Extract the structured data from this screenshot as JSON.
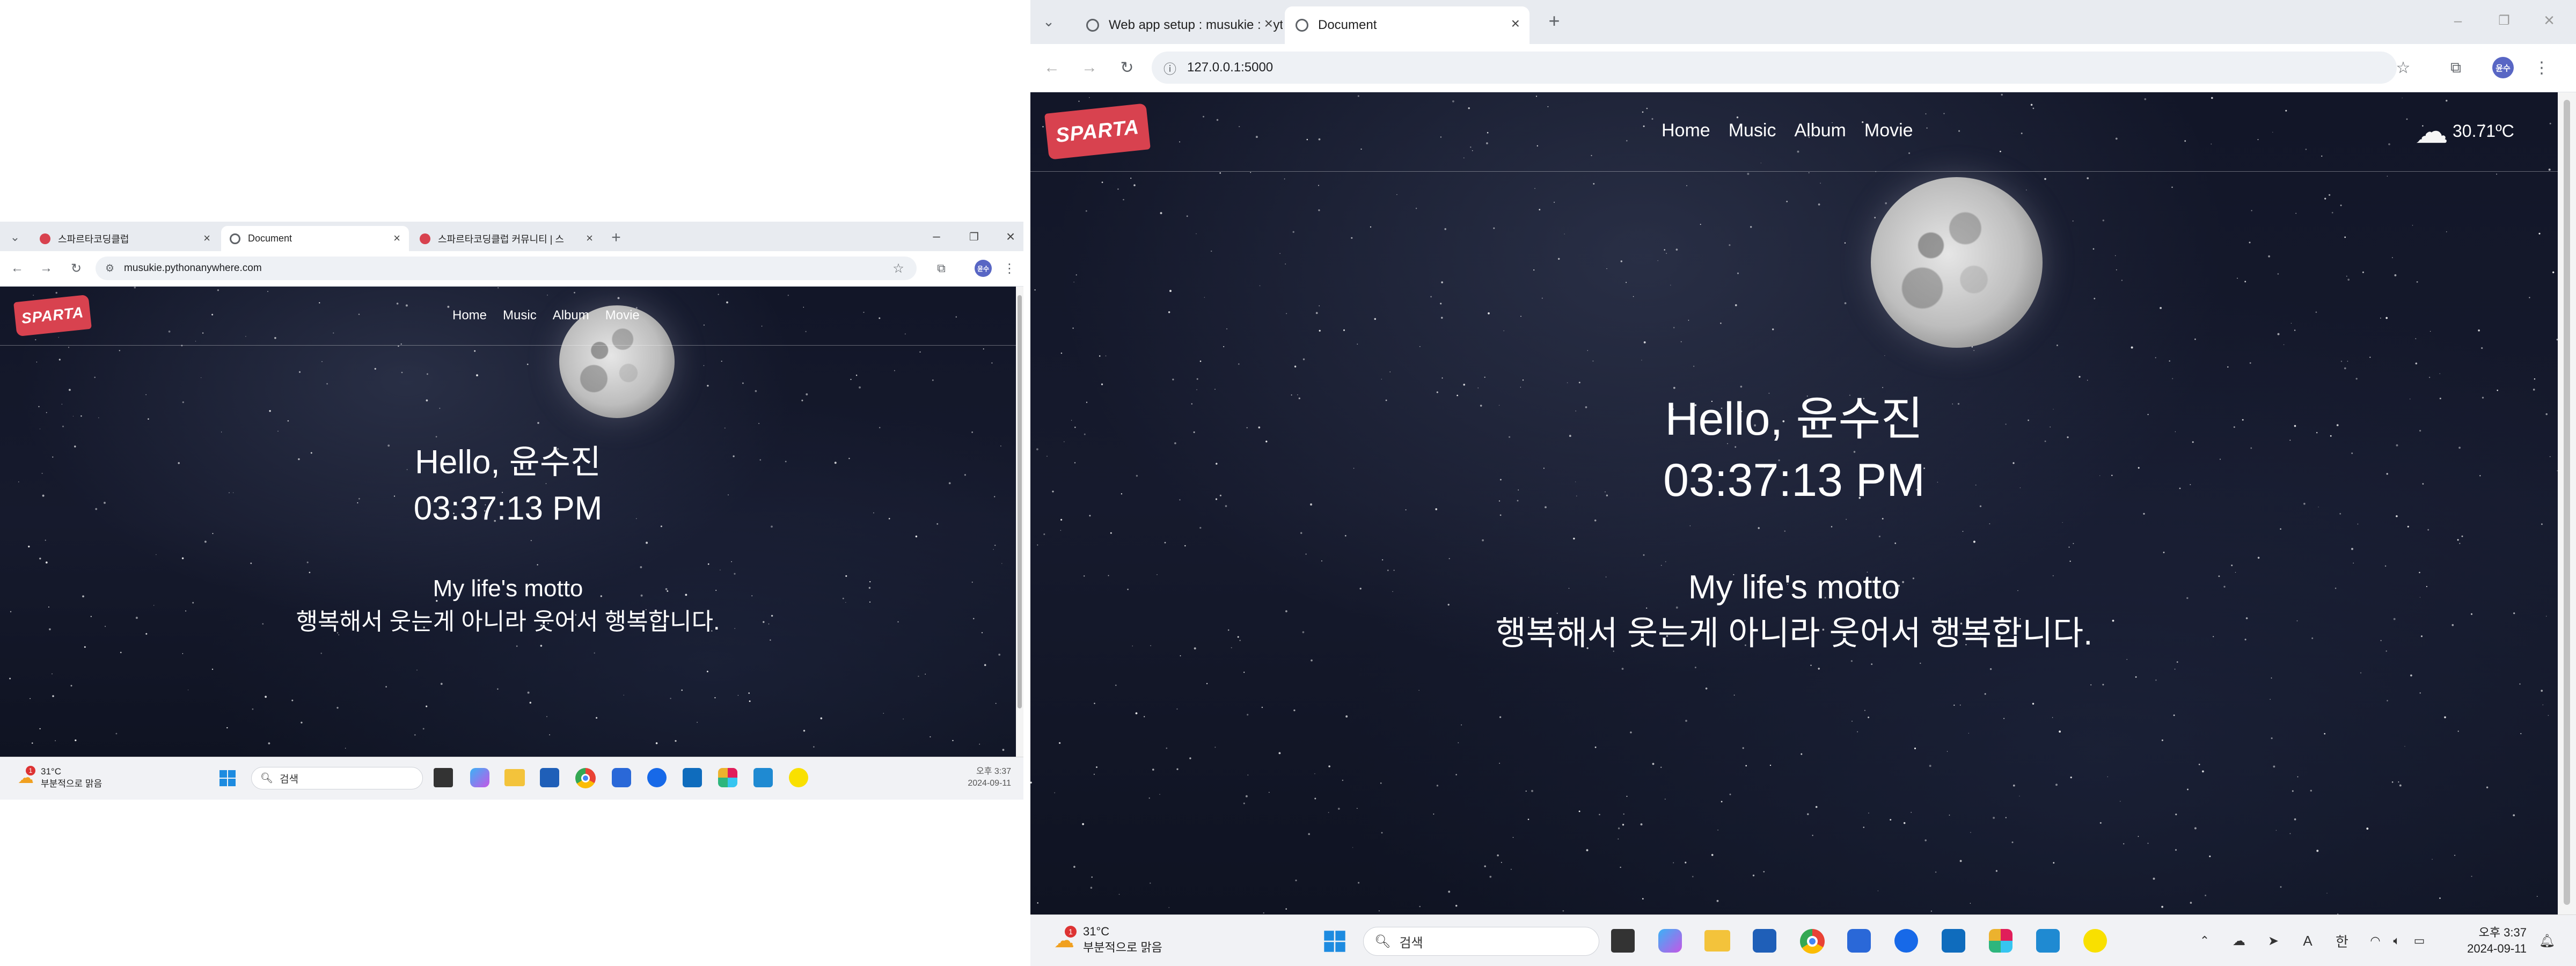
{
  "left_window": {
    "tabs": [
      {
        "title": "스파르타코딩클럽",
        "active": false
      },
      {
        "title": "Document",
        "active": true
      },
      {
        "title": "스파르타코딩클럽 커뮤니티 | 스",
        "active": false
      }
    ],
    "url": "musukie.pythonanywhere.com",
    "avatar_label": "윤수",
    "site": {
      "logo": "SPARTA",
      "nav": [
        "Home",
        "Music",
        "Album",
        "Movie"
      ],
      "greeting": "Hello, 윤수진",
      "time": "03:37:13 PM",
      "motto_title": "My life's motto",
      "motto": "행복해서 웃는게 아니라 웃어서 행복합니다."
    },
    "taskbar": {
      "weather_temp": "31°C",
      "weather_desc": "부분적으로 맑음",
      "weather_badge": "1",
      "search_placeholder": "검색",
      "clock_time": "오후 3:37",
      "clock_date": "2024-09-11"
    }
  },
  "right_window": {
    "tabs": [
      {
        "title": "Web app setup : musukie : Pyt",
        "active": false
      },
      {
        "title": "Document",
        "active": true
      }
    ],
    "url": "127.0.0.1:5000",
    "avatar_label": "윤수",
    "site": {
      "logo": "SPARTA",
      "nav": [
        "Home",
        "Music",
        "Album",
        "Movie"
      ],
      "weather": "30.71ºC",
      "greeting": "Hello, 윤수진",
      "time": "03:37:13 PM",
      "motto_title": "My life's motto",
      "motto": "행복해서 웃는게 아니라 웃어서 행복합니다."
    },
    "taskbar": {
      "weather_temp": "31°C",
      "weather_desc": "부분적으로 맑음",
      "weather_badge": "1",
      "search_placeholder": "검색",
      "tray_ime": "한",
      "tray_a": "A",
      "clock_time": "오후 3:37",
      "clock_date": "2024-09-11"
    }
  },
  "icons": {
    "back": "arrow-left-icon",
    "forward": "arrow-right-icon",
    "reload": "reload-icon",
    "site_info": "site-info-icon",
    "bookmark": "star-icon",
    "extensions": "puzzle-icon",
    "menu": "kebab-icon"
  },
  "colors": {
    "logo_red": "#d8424f",
    "page_bg": "#141829",
    "chrome_bg": "#e8ebf0",
    "taskbar_bg": "#f1f2f5"
  }
}
